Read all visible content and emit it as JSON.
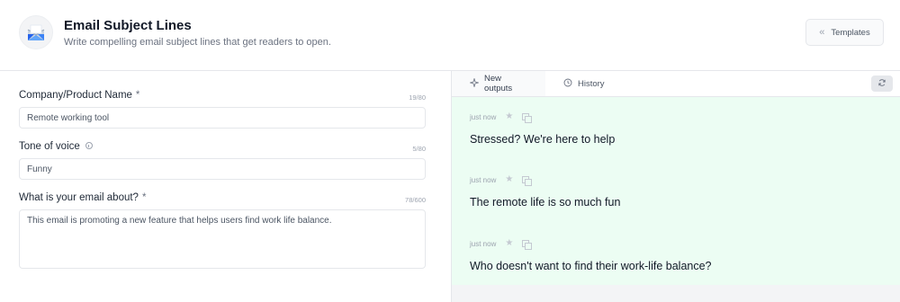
{
  "header": {
    "title": "Email Subject Lines",
    "subtitle": "Write compelling email subject lines that get readers to open.",
    "templates_label": "Templates",
    "app_icon": "envelope-icon"
  },
  "form": {
    "fields": [
      {
        "label": "Company/Product Name",
        "required": "*",
        "counter": "19/80",
        "value": "Remote working tool"
      },
      {
        "label": "Tone of voice",
        "counter": "5/80",
        "value": "Funny"
      },
      {
        "label": "What is your email about?",
        "required": "*",
        "counter": "78/600",
        "value": "This email is promoting a new feature that helps users find work life balance."
      }
    ]
  },
  "panel": {
    "tabs": [
      {
        "label": "New outputs",
        "icon": "sparkle-icon"
      },
      {
        "label": "History",
        "icon": "clock-icon"
      }
    ],
    "outputs": [
      {
        "time": "just now",
        "text": "Stressed? We're here to help"
      },
      {
        "time": "just now",
        "text": "The remote life is so much fun"
      },
      {
        "time": "just now",
        "text": "Who doesn't want to find their work-life balance?"
      }
    ]
  },
  "colors": {
    "output_bg": "#ecfdf3",
    "panel_bg": "#f3f4f6",
    "border": "#e5e7eb"
  }
}
